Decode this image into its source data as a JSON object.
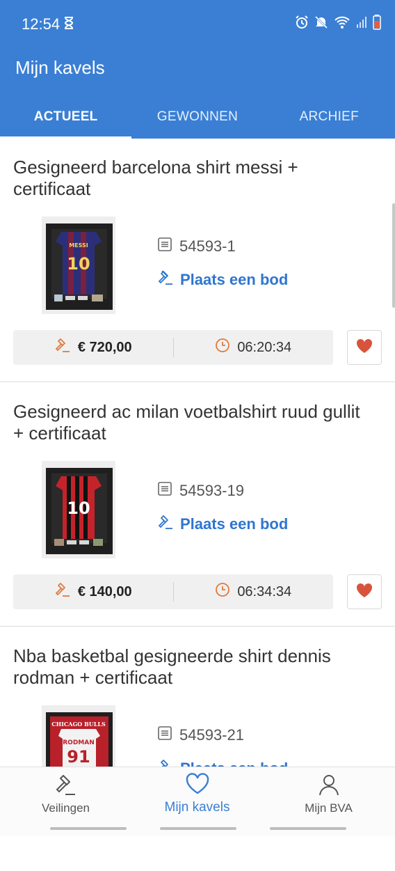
{
  "status": {
    "time": "12:54"
  },
  "header": {
    "title": "Mijn kavels"
  },
  "tabs": [
    {
      "label": "ACTUEEL",
      "active": true
    },
    {
      "label": "GEWONNEN",
      "active": false
    },
    {
      "label": "ARCHIEF",
      "active": false
    }
  ],
  "lots": [
    {
      "title": "Gesigneerd barcelona shirt messi  + certificaat",
      "lot_number": "54593-1",
      "bid_label": "Plaats een bod",
      "price": "€ 720,00",
      "time_left": "06:20:34",
      "shirt_number": "10",
      "shirt_name": "MESSI"
    },
    {
      "title": "Gesigneerd ac milan voetbalshirt ruud gullit + certificaat",
      "lot_number": "54593-19",
      "bid_label": "Plaats een bod",
      "price": "€ 140,00",
      "time_left": "06:34:34",
      "shirt_number": "10"
    },
    {
      "title": "Nba basketbal gesigneerde shirt dennis rodman + certificaat",
      "lot_number": "54593-21",
      "bid_label": "Plaats een bod",
      "shirt_number": "91",
      "shirt_name": "RODMAN",
      "team": "CHICAGO BULLS"
    }
  ],
  "bottom_nav": [
    {
      "label": "Veilingen",
      "icon": "gavel-icon"
    },
    {
      "label": "Mijn kavels",
      "icon": "heart-outline-icon",
      "active": true
    },
    {
      "label": "Mijn BVA",
      "icon": "person-icon"
    }
  ],
  "colors": {
    "primary": "#3a7fd4",
    "accent_orange": "#e07a3c",
    "favorite_red": "#d9533c",
    "link_blue": "#2f76cf"
  }
}
